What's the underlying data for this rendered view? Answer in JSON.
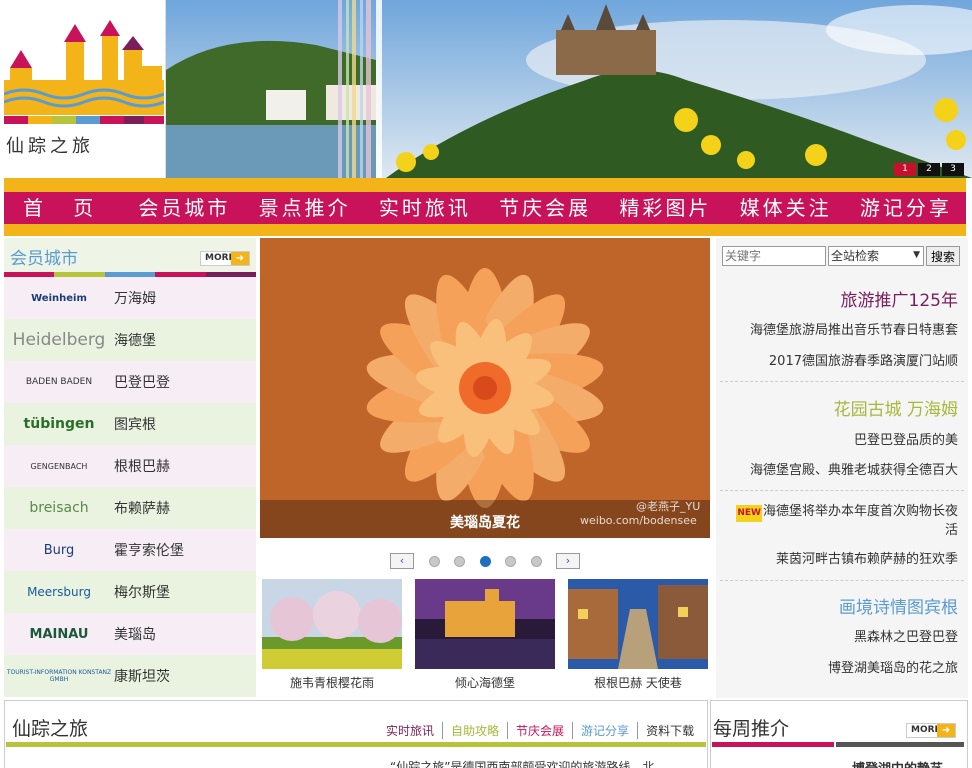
{
  "header": {
    "logo_text": "仙踪之旅",
    "banner_pages": [
      "1",
      "2",
      "3"
    ]
  },
  "nav": {
    "items": [
      "首 页",
      "会员城市",
      "景点推介",
      "实时旅讯",
      "节庆会展",
      "精彩图片",
      "媒体关注",
      "游记分享"
    ]
  },
  "left": {
    "title": "会员城市",
    "more": "MORE",
    "cities": [
      {
        "logo": "Weinheim",
        "name": "万海姆"
      },
      {
        "logo": "Heidelberg",
        "name": "海德堡"
      },
      {
        "logo": "BADEN BADEN",
        "name": "巴登巴登"
      },
      {
        "logo": "tübingen",
        "name": "图宾根"
      },
      {
        "logo": "GENGENBACH",
        "name": "根根巴赫"
      },
      {
        "logo": "breisach",
        "name": "布赖萨赫"
      },
      {
        "logo": "Burg",
        "name": "霍亨索伦堡"
      },
      {
        "logo": "Meersburg",
        "name": "梅尔斯堡"
      },
      {
        "logo": "MAINAU",
        "name": "美瑙岛"
      },
      {
        "logo": "TOURIST-INFORMATION KONSTANZ GMBH",
        "name": "康斯坦茨"
      }
    ]
  },
  "center": {
    "hero_caption": "美瑙岛夏花",
    "hero_watermark_1": "@老燕子_YU",
    "hero_watermark_2": "weibo.com/bodensee",
    "prev": "‹",
    "next": "›",
    "thumbs": [
      {
        "caption": "施韦青根樱花雨"
      },
      {
        "caption": "倾心海德堡"
      },
      {
        "caption": "根根巴赫 天使巷"
      }
    ]
  },
  "right": {
    "search_placeholder": "关键字",
    "search_scope": "全站检索",
    "search_button": "搜索",
    "sections": [
      {
        "title": "旅游推广125年",
        "color": "#7a1f5c",
        "items": [
          "海德堡旅游局推出音乐节春日特惠套",
          "2017德国旅游春季路演厦门站顺"
        ]
      },
      {
        "title": "花园古城 万海姆",
        "color": "#a8b83a",
        "items": [
          "巴登巴登品质的美",
          "海德堡宫殿、典雅老城获得全德百大"
        ]
      },
      {
        "title": "",
        "color": "#333333",
        "items": [
          "海德堡将举办本年度首次购物长夜活",
          "莱茵河畔古镇布赖萨赫的狂欢季"
        ]
      },
      {
        "title": "画境诗情图宾根",
        "color": "#5a9bd3",
        "items": [
          "黑森林之巴登巴登",
          "博登湖美瑙岛的花之旅"
        ]
      }
    ],
    "new_tag": "NEW"
  },
  "bottom": {
    "left_title": "仙踪之旅",
    "left_links": [
      "实时旅讯",
      "自助攻略",
      "节庆会展",
      "游记分享",
      "资料下载"
    ],
    "left_link_colors": [
      "#7a1f5c",
      "#a8b83a",
      "#c8135b",
      "#5a9bd3",
      "#333333"
    ],
    "left_teaser": "“仙踪之旅”是德国西南部颇受欢迎的旅游路线，北",
    "right_title": "每周推介",
    "right_more": "MORE",
    "right_teaser": "博登湖中的静艺"
  }
}
